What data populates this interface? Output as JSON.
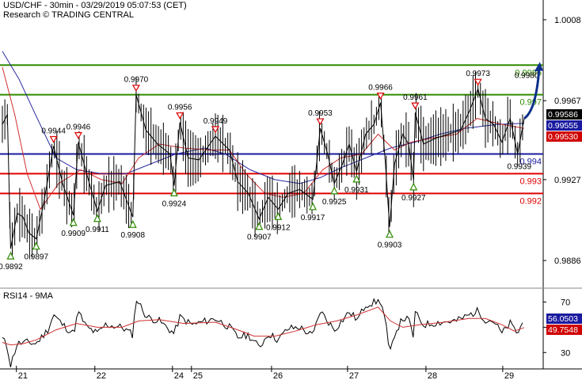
{
  "header": {
    "title": "USD/CHF - 30min - 03/29/2019 05:07:53 (CET)",
    "source": "Research © TRADING CENTRAL"
  },
  "rsi_panel_label": "RSI14 - 9MA",
  "colors": {
    "price": "#000000",
    "ma_red": "#d03030",
    "ma_blue": "#2a2aa0",
    "level_green": "#2e8b00",
    "level_blue": "#1a1aa0",
    "level_red": "#e00000",
    "arrow": "#0d2f8a",
    "marker_up": "#2e8b00",
    "marker_down": "#e00000",
    "badge_black": "#000000",
    "badge_blue": "#1a1aa0",
    "badge_red": "#d00000"
  },
  "chart_data": [
    {
      "type": "line",
      "title": "USD/CHF - 30min - 03/29/2019 05:07:53 (CET)",
      "x_ticks": [
        "21",
        "22",
        "24",
        "25",
        "26",
        "27",
        "28",
        "29"
      ],
      "y_ticks": [
        "1.0008",
        "0.9967",
        "0.9927",
        "0.9886"
      ],
      "ylim": [
        0.9872,
        1.0018
      ],
      "levels": [
        {
          "label": "0.9985",
          "value": 0.9985,
          "color": "green"
        },
        {
          "label": "0.997",
          "value": 0.997,
          "color": "green"
        },
        {
          "label": "0.994",
          "value": 0.994,
          "color": "blue"
        },
        {
          "label": "0.993",
          "value": 0.993,
          "color": "red"
        },
        {
          "label": "0.992",
          "value": 0.992,
          "color": "red"
        }
      ],
      "last_values": [
        {
          "label": "0.99586",
          "value": 0.99586,
          "color": "black"
        },
        {
          "label": "0.99555",
          "value": 0.99555,
          "color": "blue"
        },
        {
          "label": "0.99530",
          "value": 0.9953,
          "color": "red"
        }
      ],
      "highs": [
        {
          "label": "0.9944",
          "t": 6.2
        },
        {
          "label": "0.9946",
          "t": 9.2
        },
        {
          "label": "0.9970",
          "t": 16.2
        },
        {
          "label": "0.9956",
          "t": 21.5
        },
        {
          "label": "0.9949",
          "t": 25.8
        },
        {
          "label": "0.9953",
          "t": 38.5
        },
        {
          "label": "0.9966",
          "t": 45.8
        },
        {
          "label": "0.9961",
          "t": 50.0
        },
        {
          "label": "0.9973",
          "t": 57.6
        }
      ],
      "lows": [
        {
          "label": "0.9892",
          "t": 1.0
        },
        {
          "label": "0.9897",
          "t": 4.1
        },
        {
          "label": "0.9909",
          "t": 8.6
        },
        {
          "label": "0.9911",
          "t": 11.5
        },
        {
          "label": "0.9908",
          "t": 15.8
        },
        {
          "label": "0.9924",
          "t": 20.8
        },
        {
          "label": "0.9907",
          "t": 31.1
        },
        {
          "label": "0.9912",
          "t": 33.4
        },
        {
          "label": "0.9917",
          "t": 37.6
        },
        {
          "label": "0.9925",
          "t": 40.2
        },
        {
          "label": "0.9931",
          "t": 42.9
        },
        {
          "label": "0.9903",
          "t": 46.9
        },
        {
          "label": "0.9927",
          "t": 49.8
        }
      ],
      "extra_labels": [
        {
          "label": "0.9980",
          "t": 63.5,
          "value": 0.998
        },
        {
          "label": "0.9939",
          "t": 62.6,
          "value": 0.9934
        }
      ],
      "projection": {
        "from": [
          63.2,
          0.9958
        ],
        "to": [
          65.0,
          0.9985
        ]
      },
      "price_anchors": [
        [
          0.0,
          0.9955
        ],
        [
          0.6,
          0.996
        ],
        [
          1.0,
          0.9892
        ],
        [
          1.8,
          0.991
        ],
        [
          2.5,
          0.9908
        ],
        [
          3.2,
          0.99
        ],
        [
          4.1,
          0.9897
        ],
        [
          5.0,
          0.9915
        ],
        [
          6.2,
          0.9944
        ],
        [
          7.3,
          0.9925
        ],
        [
          8.6,
          0.9909
        ],
        [
          9.2,
          0.9946
        ],
        [
          10.2,
          0.993
        ],
        [
          11.5,
          0.9911
        ],
        [
          12.5,
          0.9924
        ],
        [
          14.2,
          0.9926
        ],
        [
          15.8,
          0.9908
        ],
        [
          16.2,
          0.997
        ],
        [
          17.4,
          0.9952
        ],
        [
          18.8,
          0.9945
        ],
        [
          20.3,
          0.994
        ],
        [
          20.8,
          0.9924
        ],
        [
          21.5,
          0.9956
        ],
        [
          22.5,
          0.9938
        ],
        [
          23.8,
          0.9937
        ],
        [
          25.8,
          0.9949
        ],
        [
          27.5,
          0.9942
        ],
        [
          28.5,
          0.9926
        ],
        [
          29.8,
          0.992
        ],
        [
          31.1,
          0.9907
        ],
        [
          32.2,
          0.9918
        ],
        [
          33.4,
          0.9912
        ],
        [
          34.6,
          0.992
        ],
        [
          36.0,
          0.9922
        ],
        [
          37.6,
          0.9917
        ],
        [
          38.5,
          0.9953
        ],
        [
          39.4,
          0.994
        ],
        [
          40.2,
          0.9925
        ],
        [
          41.2,
          0.9935
        ],
        [
          42.0,
          0.9945
        ],
        [
          42.9,
          0.9931
        ],
        [
          44.0,
          0.995
        ],
        [
          45.0,
          0.9955
        ],
        [
          45.8,
          0.9966
        ],
        [
          46.4,
          0.9935
        ],
        [
          46.9,
          0.9903
        ],
        [
          47.5,
          0.9935
        ],
        [
          48.5,
          0.995
        ],
        [
          49.2,
          0.9945
        ],
        [
          49.8,
          0.9927
        ],
        [
          50.0,
          0.9961
        ],
        [
          51.0,
          0.9945
        ],
        [
          52.5,
          0.9948
        ],
        [
          54.0,
          0.995
        ],
        [
          55.5,
          0.9952
        ],
        [
          56.6,
          0.9962
        ],
        [
          57.6,
          0.9973
        ],
        [
          58.5,
          0.9958
        ],
        [
          59.5,
          0.9955
        ],
        [
          60.5,
          0.9946
        ],
        [
          61.5,
          0.9958
        ],
        [
          62.4,
          0.994
        ],
        [
          63.2,
          0.9958
        ]
      ],
      "ma_red_anchors": [
        [
          0.0,
          0.9984
        ],
        [
          1.5,
          0.996
        ],
        [
          3.0,
          0.993
        ],
        [
          4.6,
          0.9912
        ],
        [
          6.8,
          0.9925
        ],
        [
          9.5,
          0.9932
        ],
        [
          12.0,
          0.9927
        ],
        [
          14.5,
          0.9925
        ],
        [
          16.5,
          0.9938
        ],
        [
          19.0,
          0.9945
        ],
        [
          22.0,
          0.9943
        ],
        [
          25.0,
          0.9942
        ],
        [
          27.5,
          0.9942
        ],
        [
          29.5,
          0.993
        ],
        [
          31.8,
          0.992
        ],
        [
          34.0,
          0.9918
        ],
        [
          36.5,
          0.992
        ],
        [
          38.8,
          0.9932
        ],
        [
          41.0,
          0.9938
        ],
        [
          43.5,
          0.994
        ],
        [
          45.5,
          0.995
        ],
        [
          47.5,
          0.9942
        ],
        [
          49.5,
          0.9946
        ],
        [
          52.0,
          0.9948
        ],
        [
          55.0,
          0.995
        ],
        [
          57.5,
          0.9958
        ],
        [
          60.5,
          0.9955
        ],
        [
          63.2,
          0.9953
        ]
      ],
      "ma_blue_anchors": [
        [
          0.0,
          0.9992
        ],
        [
          2.0,
          0.9978
        ],
        [
          4.0,
          0.996
        ],
        [
          6.5,
          0.9938
        ],
        [
          9.0,
          0.9932
        ],
        [
          12.0,
          0.993
        ],
        [
          15.0,
          0.993
        ],
        [
          18.0,
          0.9935
        ],
        [
          21.0,
          0.994
        ],
        [
          24.5,
          0.9943
        ],
        [
          27.0,
          0.994
        ],
        [
          30.0,
          0.9932
        ],
        [
          33.0,
          0.9927
        ],
        [
          36.0,
          0.9925
        ],
        [
          38.5,
          0.9928
        ],
        [
          41.0,
          0.9933
        ],
        [
          44.0,
          0.9938
        ],
        [
          47.0,
          0.9943
        ],
        [
          50.0,
          0.9946
        ],
        [
          53.0,
          0.995
        ],
        [
          56.0,
          0.9953
        ],
        [
          60.0,
          0.9955
        ],
        [
          63.2,
          0.99555
        ]
      ]
    },
    {
      "type": "line",
      "title": "RSI14 - 9MA",
      "y_ticks": [
        "70",
        "50",
        "30"
      ],
      "ylim": [
        17,
        81
      ],
      "last_values": [
        {
          "label": "56.0503",
          "value": 56.05,
          "color": "blue"
        },
        {
          "label": "49.7548",
          "value": 49.75,
          "color": "red"
        }
      ],
      "rsi_anchors": [
        [
          0.0,
          41
        ],
        [
          0.6,
          35
        ],
        [
          1.0,
          20
        ],
        [
          1.8,
          37
        ],
        [
          3.0,
          38
        ],
        [
          4.1,
          37
        ],
        [
          5.5,
          48
        ],
        [
          6.2,
          60
        ],
        [
          7.3,
          52
        ],
        [
          8.6,
          45
        ],
        [
          9.2,
          62
        ],
        [
          10.2,
          50
        ],
        [
          11.5,
          45
        ],
        [
          12.5,
          52
        ],
        [
          14.5,
          50
        ],
        [
          15.8,
          44
        ],
        [
          16.2,
          73
        ],
        [
          17.5,
          58
        ],
        [
          19.0,
          55
        ],
        [
          20.8,
          45
        ],
        [
          21.5,
          58
        ],
        [
          23.0,
          52
        ],
        [
          25.8,
          57
        ],
        [
          27.5,
          50
        ],
        [
          28.5,
          42
        ],
        [
          29.8,
          44
        ],
        [
          31.1,
          34
        ],
        [
          32.2,
          45
        ],
        [
          33.4,
          40
        ],
        [
          34.6,
          49
        ],
        [
          36.0,
          50
        ],
        [
          37.6,
          43
        ],
        [
          38.5,
          63
        ],
        [
          39.4,
          55
        ],
        [
          40.2,
          48
        ],
        [
          42.0,
          62
        ],
        [
          43.0,
          56
        ],
        [
          44.0,
          68
        ],
        [
          45.8,
          71
        ],
        [
          46.4,
          55
        ],
        [
          46.9,
          27
        ],
        [
          47.5,
          45
        ],
        [
          48.5,
          57
        ],
        [
          49.2,
          56
        ],
        [
          49.8,
          42
        ],
        [
          50.0,
          61
        ],
        [
          51.0,
          52
        ],
        [
          53.0,
          54
        ],
        [
          55.0,
          55
        ],
        [
          57.6,
          63
        ],
        [
          58.5,
          56
        ],
        [
          59.5,
          55
        ],
        [
          60.5,
          45
        ],
        [
          61.5,
          53
        ],
        [
          62.4,
          45
        ],
        [
          63.2,
          56
        ]
      ],
      "rsi_ma_anchors": [
        [
          0.0,
          38
        ],
        [
          1.0,
          36
        ],
        [
          2.5,
          37
        ],
        [
          4.1,
          40
        ],
        [
          6.5,
          48
        ],
        [
          9.0,
          53
        ],
        [
          11.5,
          50
        ],
        [
          14.5,
          50
        ],
        [
          16.5,
          55
        ],
        [
          19.0,
          56
        ],
        [
          22.0,
          53
        ],
        [
          25.8,
          54
        ],
        [
          28.5,
          48
        ],
        [
          30.5,
          43
        ],
        [
          33.0,
          43
        ],
        [
          35.5,
          47
        ],
        [
          38.0,
          52
        ],
        [
          40.5,
          55
        ],
        [
          43.0,
          60
        ],
        [
          45.5,
          66
        ],
        [
          47.0,
          55
        ],
        [
          48.5,
          50
        ],
        [
          50.5,
          52
        ],
        [
          53.5,
          54
        ],
        [
          56.5,
          57
        ],
        [
          58.5,
          57
        ],
        [
          60.5,
          52
        ],
        [
          62.0,
          47
        ],
        [
          63.2,
          49.75
        ]
      ]
    }
  ]
}
